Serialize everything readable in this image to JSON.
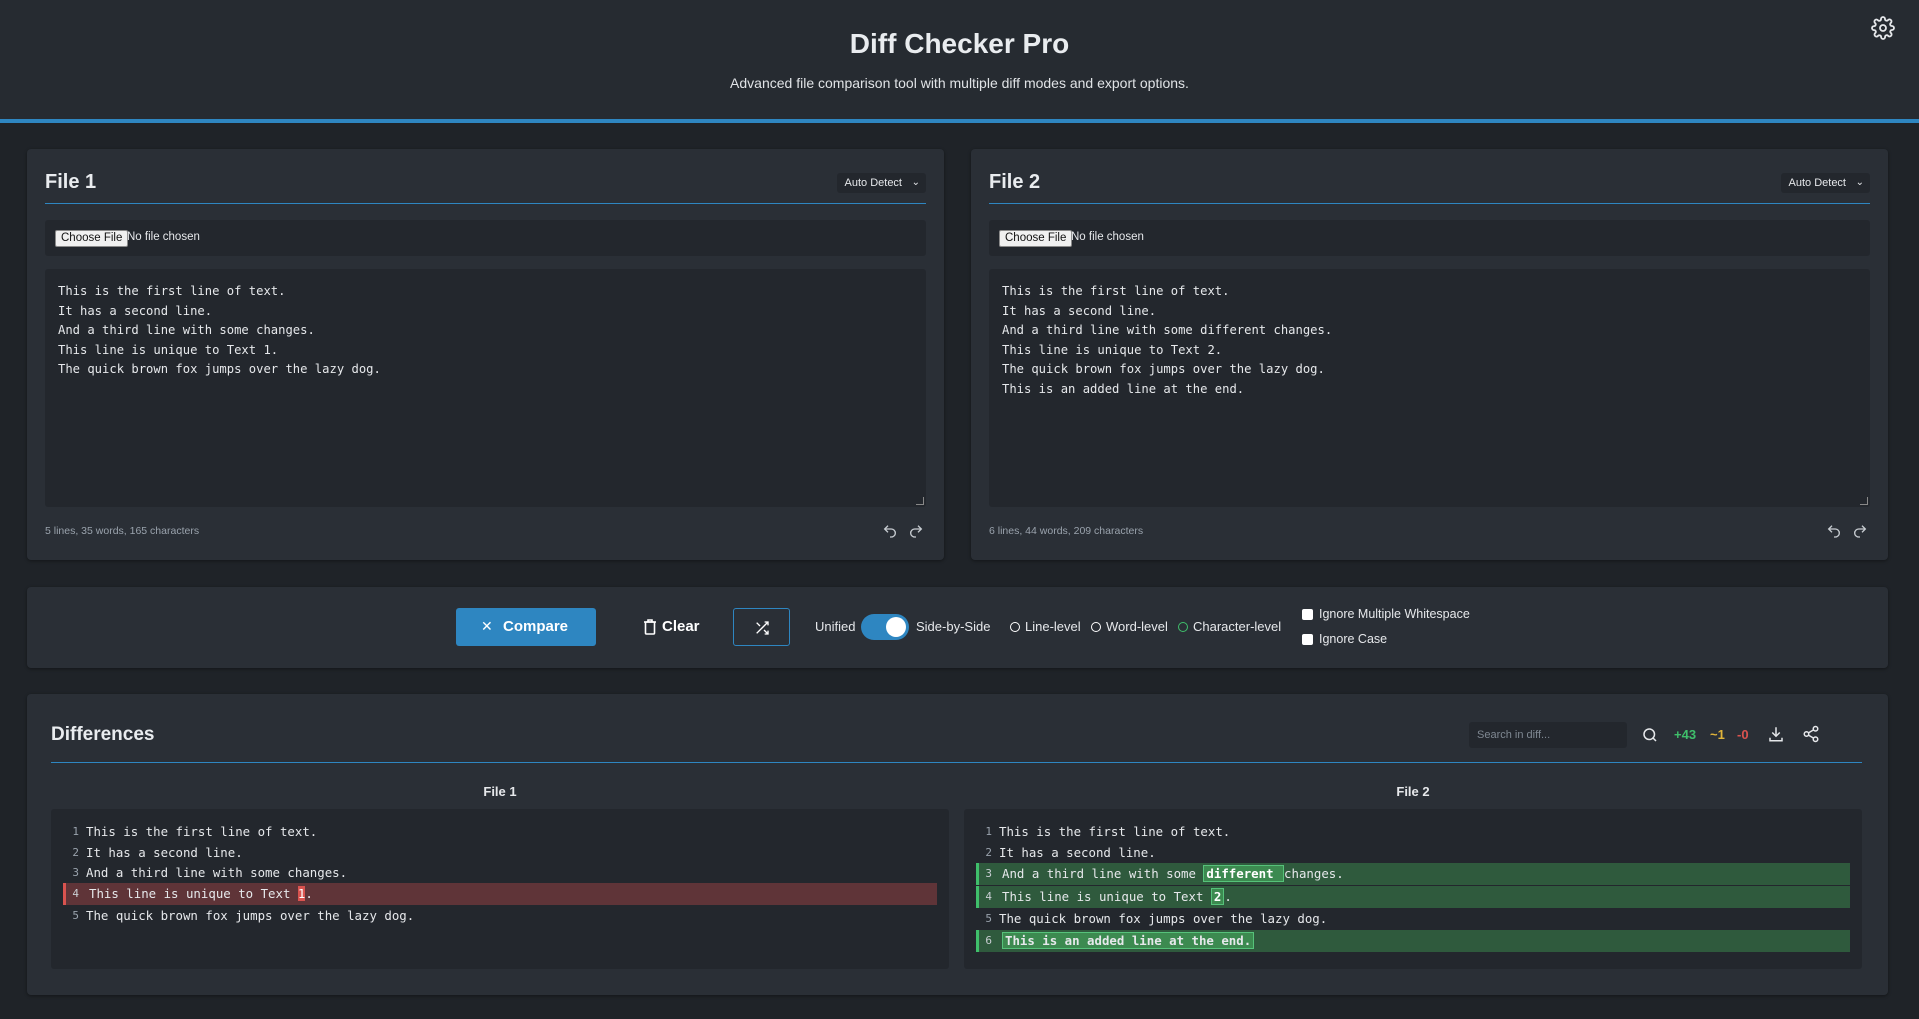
{
  "app": {
    "title": "Diff Checker Pro",
    "subtitle": "Advanced file comparison tool with multiple diff modes and export options."
  },
  "files": [
    {
      "title": "File 1",
      "mode": "Auto Detect",
      "choose_label": "Choose File",
      "file_status": "No file chosen",
      "content": "This is the first line of text.\nIt has a second line.\nAnd a third line with some changes.\nThis line is unique to Text 1.\nThe quick brown fox jumps over the lazy dog.",
      "stats": "5 lines, 35 words, 165 characters"
    },
    {
      "title": "File 2",
      "mode": "Auto Detect",
      "choose_label": "Choose File",
      "file_status": "No file chosen",
      "content": "This is the first line of text.\nIt has a second line.\nAnd a third line with some different changes.\nThis line is unique to Text 2.\nThe quick brown fox jumps over the lazy dog.\nThis is an added line at the end.",
      "stats": "6 lines, 44 words, 209 characters"
    }
  ],
  "toolbar": {
    "compare_label": "Compare",
    "clear_label": "Clear",
    "view_unified": "Unified",
    "view_side": "Side-by-Side",
    "view_side_by_side_on": true,
    "modes": [
      {
        "label": "Line-level",
        "selected": false
      },
      {
        "label": "Word-level",
        "selected": false
      },
      {
        "label": "Character-level",
        "selected": true
      }
    ],
    "options": [
      {
        "label": "Ignore Multiple Whitespace",
        "checked": false
      },
      {
        "label": "Ignore Case",
        "checked": false
      }
    ]
  },
  "differences": {
    "title": "Differences",
    "search_placeholder": "Search in diff...",
    "added_count": "+43",
    "changed_count": "~1",
    "removed_count": "-0",
    "left_header": "File 1",
    "right_header": "File 2",
    "left_lines": [
      {
        "n": "1",
        "pre": "This is the first line of text.",
        "hl": "",
        "post": "",
        "type": "same"
      },
      {
        "n": "2",
        "pre": "It has a second line.",
        "hl": "",
        "post": "",
        "type": "same"
      },
      {
        "n": "3",
        "pre": "And a third line with some changes.",
        "hl": "",
        "post": "",
        "type": "same"
      },
      {
        "n": "4",
        "pre": "This line is unique to Text ",
        "hl": "1",
        "post": ".",
        "type": "del"
      },
      {
        "n": "5",
        "pre": "The quick brown fox jumps over the lazy dog.",
        "hl": "",
        "post": "",
        "type": "same"
      }
    ],
    "right_lines": [
      {
        "n": "1",
        "pre": "This is the first line of text.",
        "hl": "",
        "post": "",
        "type": "same"
      },
      {
        "n": "2",
        "pre": "It has a second line.",
        "hl": "",
        "post": "",
        "type": "same"
      },
      {
        "n": "3",
        "pre": "And a third line with some ",
        "hl": "different ",
        "post": "changes.",
        "type": "add"
      },
      {
        "n": "4",
        "pre": "This line is unique to Text ",
        "hl": "2",
        "post": ".",
        "type": "add"
      },
      {
        "n": "5",
        "pre": "The quick brown fox jumps over the lazy dog.",
        "hl": "",
        "post": "",
        "type": "same"
      },
      {
        "n": "6",
        "pre": "",
        "hl": "This is an added line at the end.",
        "post": "",
        "type": "add-full"
      }
    ]
  },
  "colors": {
    "accent": "#2e86c1",
    "added": "#3fbf6b",
    "changed": "#e0b43a",
    "removed": "#d9534f"
  },
  "icons": [
    "gear-icon",
    "chevron-down-icon",
    "undo-icon",
    "redo-icon",
    "close-icon",
    "trash-icon",
    "shuffle-icon",
    "search-icon",
    "download-icon",
    "share-icon"
  ]
}
